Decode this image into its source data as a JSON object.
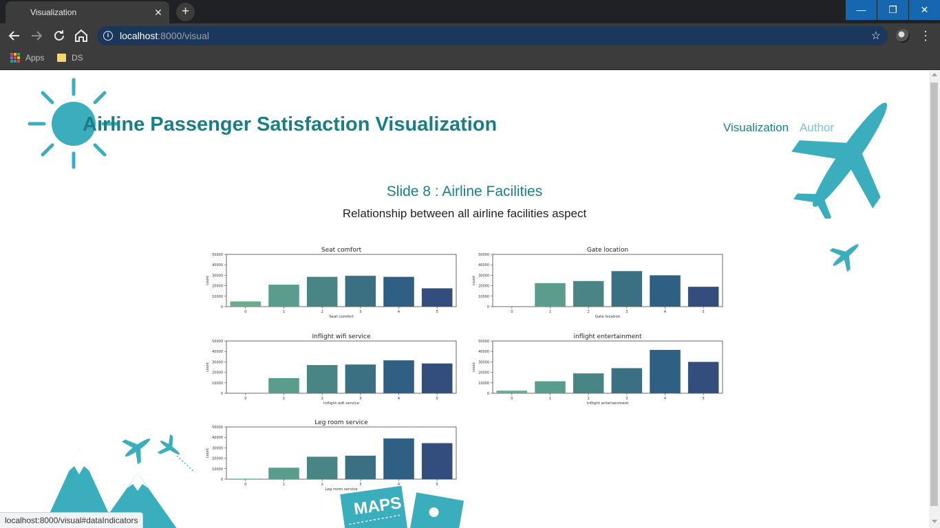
{
  "browser": {
    "tab_title": "Visualization",
    "tab_close": "✕",
    "new_tab": "+",
    "url_host": "localhost",
    "url_path": ":8000/visual",
    "bookmarks": [
      {
        "label": "Apps",
        "icon": "apps-grid-icon"
      },
      {
        "label": "DS",
        "icon": "folder-icon"
      }
    ],
    "window_controls": {
      "minimize": "—",
      "restore": "❐",
      "close": "✕"
    },
    "status_text": "localhost:8000/visual#dataIndicators"
  },
  "page": {
    "title": "Airline Passenger Satisfaction Visualization",
    "nav": [
      {
        "label": "Visualization"
      },
      {
        "label": "Author"
      }
    ],
    "slide_title": "Slide 8 : Airline Facilities",
    "slide_subtitle": "Relationship between all airline facilities aspect"
  },
  "colors": {
    "accent": "#197f86",
    "deco": "#3aaebd",
    "bars": [
      "#6aab8e",
      "#5a9d8c",
      "#4a8586",
      "#3a7082",
      "#2f5f82",
      "#334d7d"
    ]
  },
  "chart_data": [
    {
      "type": "bar",
      "title": "Seat comfort",
      "xlabel": "Seat comfort",
      "ylabel": "count",
      "categories": [
        "0",
        "1",
        "2",
        "3",
        "4",
        "5"
      ],
      "values": [
        5000,
        21000,
        28500,
        29500,
        28500,
        17500
      ],
      "ylim": [
        0,
        50000
      ],
      "yticks": [
        0,
        10000,
        20000,
        30000,
        40000,
        50000
      ]
    },
    {
      "type": "bar",
      "title": "Gate location",
      "xlabel": "Gate location",
      "ylabel": "count",
      "categories": [
        "0",
        "1",
        "2",
        "3",
        "4",
        "5"
      ],
      "values": [
        0,
        22500,
        24500,
        34000,
        30000,
        19000
      ],
      "ylim": [
        0,
        50000
      ],
      "yticks": [
        0,
        10000,
        20000,
        30000,
        40000,
        50000
      ]
    },
    {
      "type": "bar",
      "title": "Inflight wifi service",
      "xlabel": "Inflight wifi service",
      "ylabel": "count",
      "categories": [
        "0",
        "1",
        "2",
        "3",
        "4",
        "5"
      ],
      "values": [
        0,
        14500,
        27000,
        27500,
        31500,
        28500
      ],
      "ylim": [
        0,
        50000
      ],
      "yticks": [
        0,
        10000,
        20000,
        30000,
        40000,
        50000
      ]
    },
    {
      "type": "bar",
      "title": "inflight entertainment",
      "xlabel": "Inflight entertainment",
      "ylabel": "count",
      "categories": [
        "0",
        "1",
        "2",
        "3",
        "4",
        "5"
      ],
      "values": [
        2500,
        11500,
        19000,
        24000,
        41500,
        30000
      ],
      "ylim": [
        0,
        50000
      ],
      "yticks": [
        0,
        10000,
        20000,
        30000,
        40000,
        50000
      ]
    },
    {
      "type": "bar",
      "title": "Leg room service",
      "xlabel": "Leg room service",
      "ylabel": "count",
      "categories": [
        "0",
        "1",
        "2",
        "3",
        "4",
        "5"
      ],
      "values": [
        500,
        11000,
        21500,
        22500,
        39000,
        34500
      ],
      "ylim": [
        0,
        50000
      ],
      "yticks": [
        0,
        10000,
        20000,
        30000,
        40000,
        50000
      ]
    }
  ]
}
